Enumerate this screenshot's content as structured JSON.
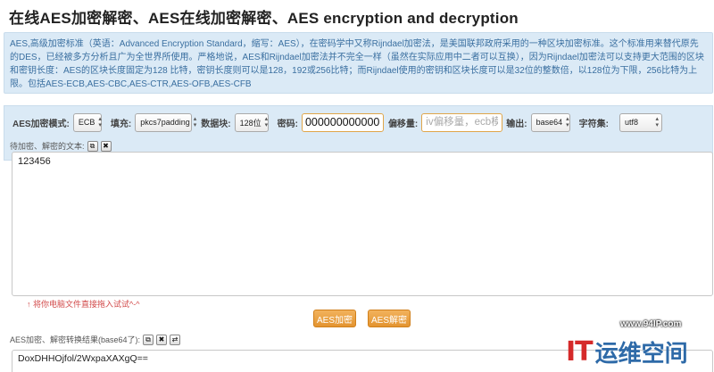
{
  "page": {
    "title": "在线AES加密解密、AES在线加密解密、AES encryption and decryption",
    "info": "AES,高级加密标准（英语：Advanced Encryption Standard，缩写：AES），在密码学中又称Rijndael加密法，是美国联邦政府采用的一种区块加密标准。这个标准用来替代原先的DES，已经被多方分析且广为全世界所使用。严格地说，AES和Rijndael加密法并不完全一样（虽然在实际应用中二者可以互换），因为Rijndael加密法可以支持更大范围的区块和密钥长度：AES的区块长度固定为128 比特，密钥长度则可以是128，192或256比特；而Rijndael使用的密钥和区块长度可以是32位的整数倍，以128位为下限，256比特为上限。包括AES-ECB,AES-CBC,AES-CTR,AES-OFB,AES-CFB"
  },
  "controls": {
    "mode_label": "AES加密模式:",
    "mode_value": "ECB",
    "padding_label": "填充:",
    "padding_value": "pkcs7padding",
    "block_label": "数据块:",
    "block_value": "128位",
    "password_label": "密码:",
    "password_value": "000000000000",
    "iv_label": "偏移量:",
    "iv_placeholder": "iv偏移量，ecb模式不用填写",
    "output_label": "输出:",
    "output_value": "base64",
    "charset_label": "字符集:",
    "charset_value": "utf8"
  },
  "source": {
    "label": "待加密、解密的文本:",
    "text": "123456",
    "drag_hint": "↑ 将你电脑文件直接拖入试试^-^"
  },
  "actions": {
    "encrypt": "AES加密",
    "decrypt": "AES解密"
  },
  "result": {
    "label": "AES加密、解密转换结果(base64了):",
    "text": "DoxDHHOjfol/2WxpaXAXgQ=="
  },
  "watermark": {
    "url": "www.94IP.com",
    "logo_it": "IT",
    "logo_cn": "运维空间"
  }
}
